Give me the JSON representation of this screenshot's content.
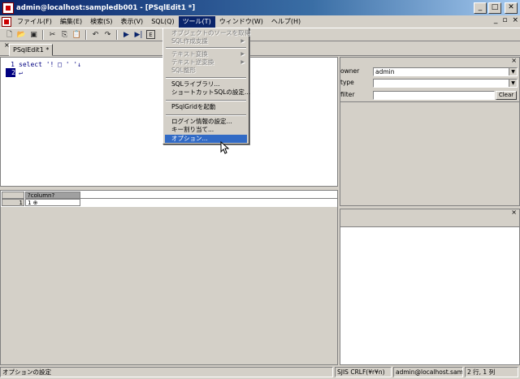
{
  "window": {
    "title": "admin@localhost:sampledb001 - [PSqlEdit1 *]",
    "minimize": "_",
    "maximize": "□",
    "close": "✕"
  },
  "menubar": {
    "items": [
      "ファイル(F)",
      "編集(E)",
      "検索(S)",
      "表示(V)",
      "SQL(Q)",
      "ツール(T)",
      "ウィンドウ(W)",
      "ヘルプ(H)"
    ],
    "active_index": 5,
    "mdi_controls": [
      "_",
      "▫",
      "×"
    ]
  },
  "toolbar": {
    "buttons": [
      "new-icon",
      "open-icon",
      "save-icon",
      "cut-icon",
      "copy-icon",
      "paste-icon",
      "undo-icon",
      "redo-icon",
      "run-icon",
      "run-step-icon",
      "explain-icon"
    ],
    "glyphs": [
      "🗋",
      "📂",
      "▣",
      "✂",
      "⎘",
      "📋",
      "↶",
      "↷",
      "▶",
      "▶|",
      "E"
    ]
  },
  "tabs": {
    "close": "×",
    "items": [
      "PSqlEdit1 *"
    ]
  },
  "editor": {
    "lines": [
      {
        "num": "1",
        "code": "select '! □ ' '↓"
      },
      {
        "num": "2",
        "code": "↵"
      }
    ]
  },
  "grid": {
    "column_header": "?column?",
    "row_header": "1",
    "cell_value": "1    ⊕"
  },
  "right_panel": {
    "owner_label": "owner",
    "owner_value": "admin",
    "type_label": "type",
    "type_value": "",
    "filter_label": "filter",
    "filter_value": "",
    "clear_label": "Clear",
    "close": "×"
  },
  "right_bottom": {
    "close": "×"
  },
  "tool_menu": {
    "items": [
      {
        "label": "オブジェクトのソースを取得",
        "disabled": true,
        "submenu": false
      },
      {
        "label": "SQL作成支援",
        "disabled": true,
        "submenu": true
      },
      {
        "label": "テキスト変換",
        "disabled": true,
        "submenu": true
      },
      {
        "label": "テキスト逆変換",
        "disabled": true,
        "submenu": true
      },
      {
        "label": "SQL整形",
        "disabled": true,
        "submenu": false
      },
      {
        "label": "SQLライブラリ...",
        "disabled": false,
        "submenu": false
      },
      {
        "label": "ショートカットSQLの設定...",
        "disabled": false,
        "submenu": false
      },
      {
        "label": "PSqlGridを起動",
        "disabled": false,
        "submenu": false
      },
      {
        "label": "ログイン情報の設定...",
        "disabled": false,
        "submenu": false
      },
      {
        "label": "キー割り当て...",
        "disabled": false,
        "submenu": false
      },
      {
        "label": "オプション...",
        "disabled": false,
        "submenu": false,
        "selected": true
      }
    ],
    "submenu_arrow": "▶"
  },
  "statusbar": {
    "message": "オプションの設定",
    "encoding": "SJIS CRLF(¥r¥n)",
    "connection": "admin@localhost.sample",
    "position": "2 行, 1 列"
  }
}
